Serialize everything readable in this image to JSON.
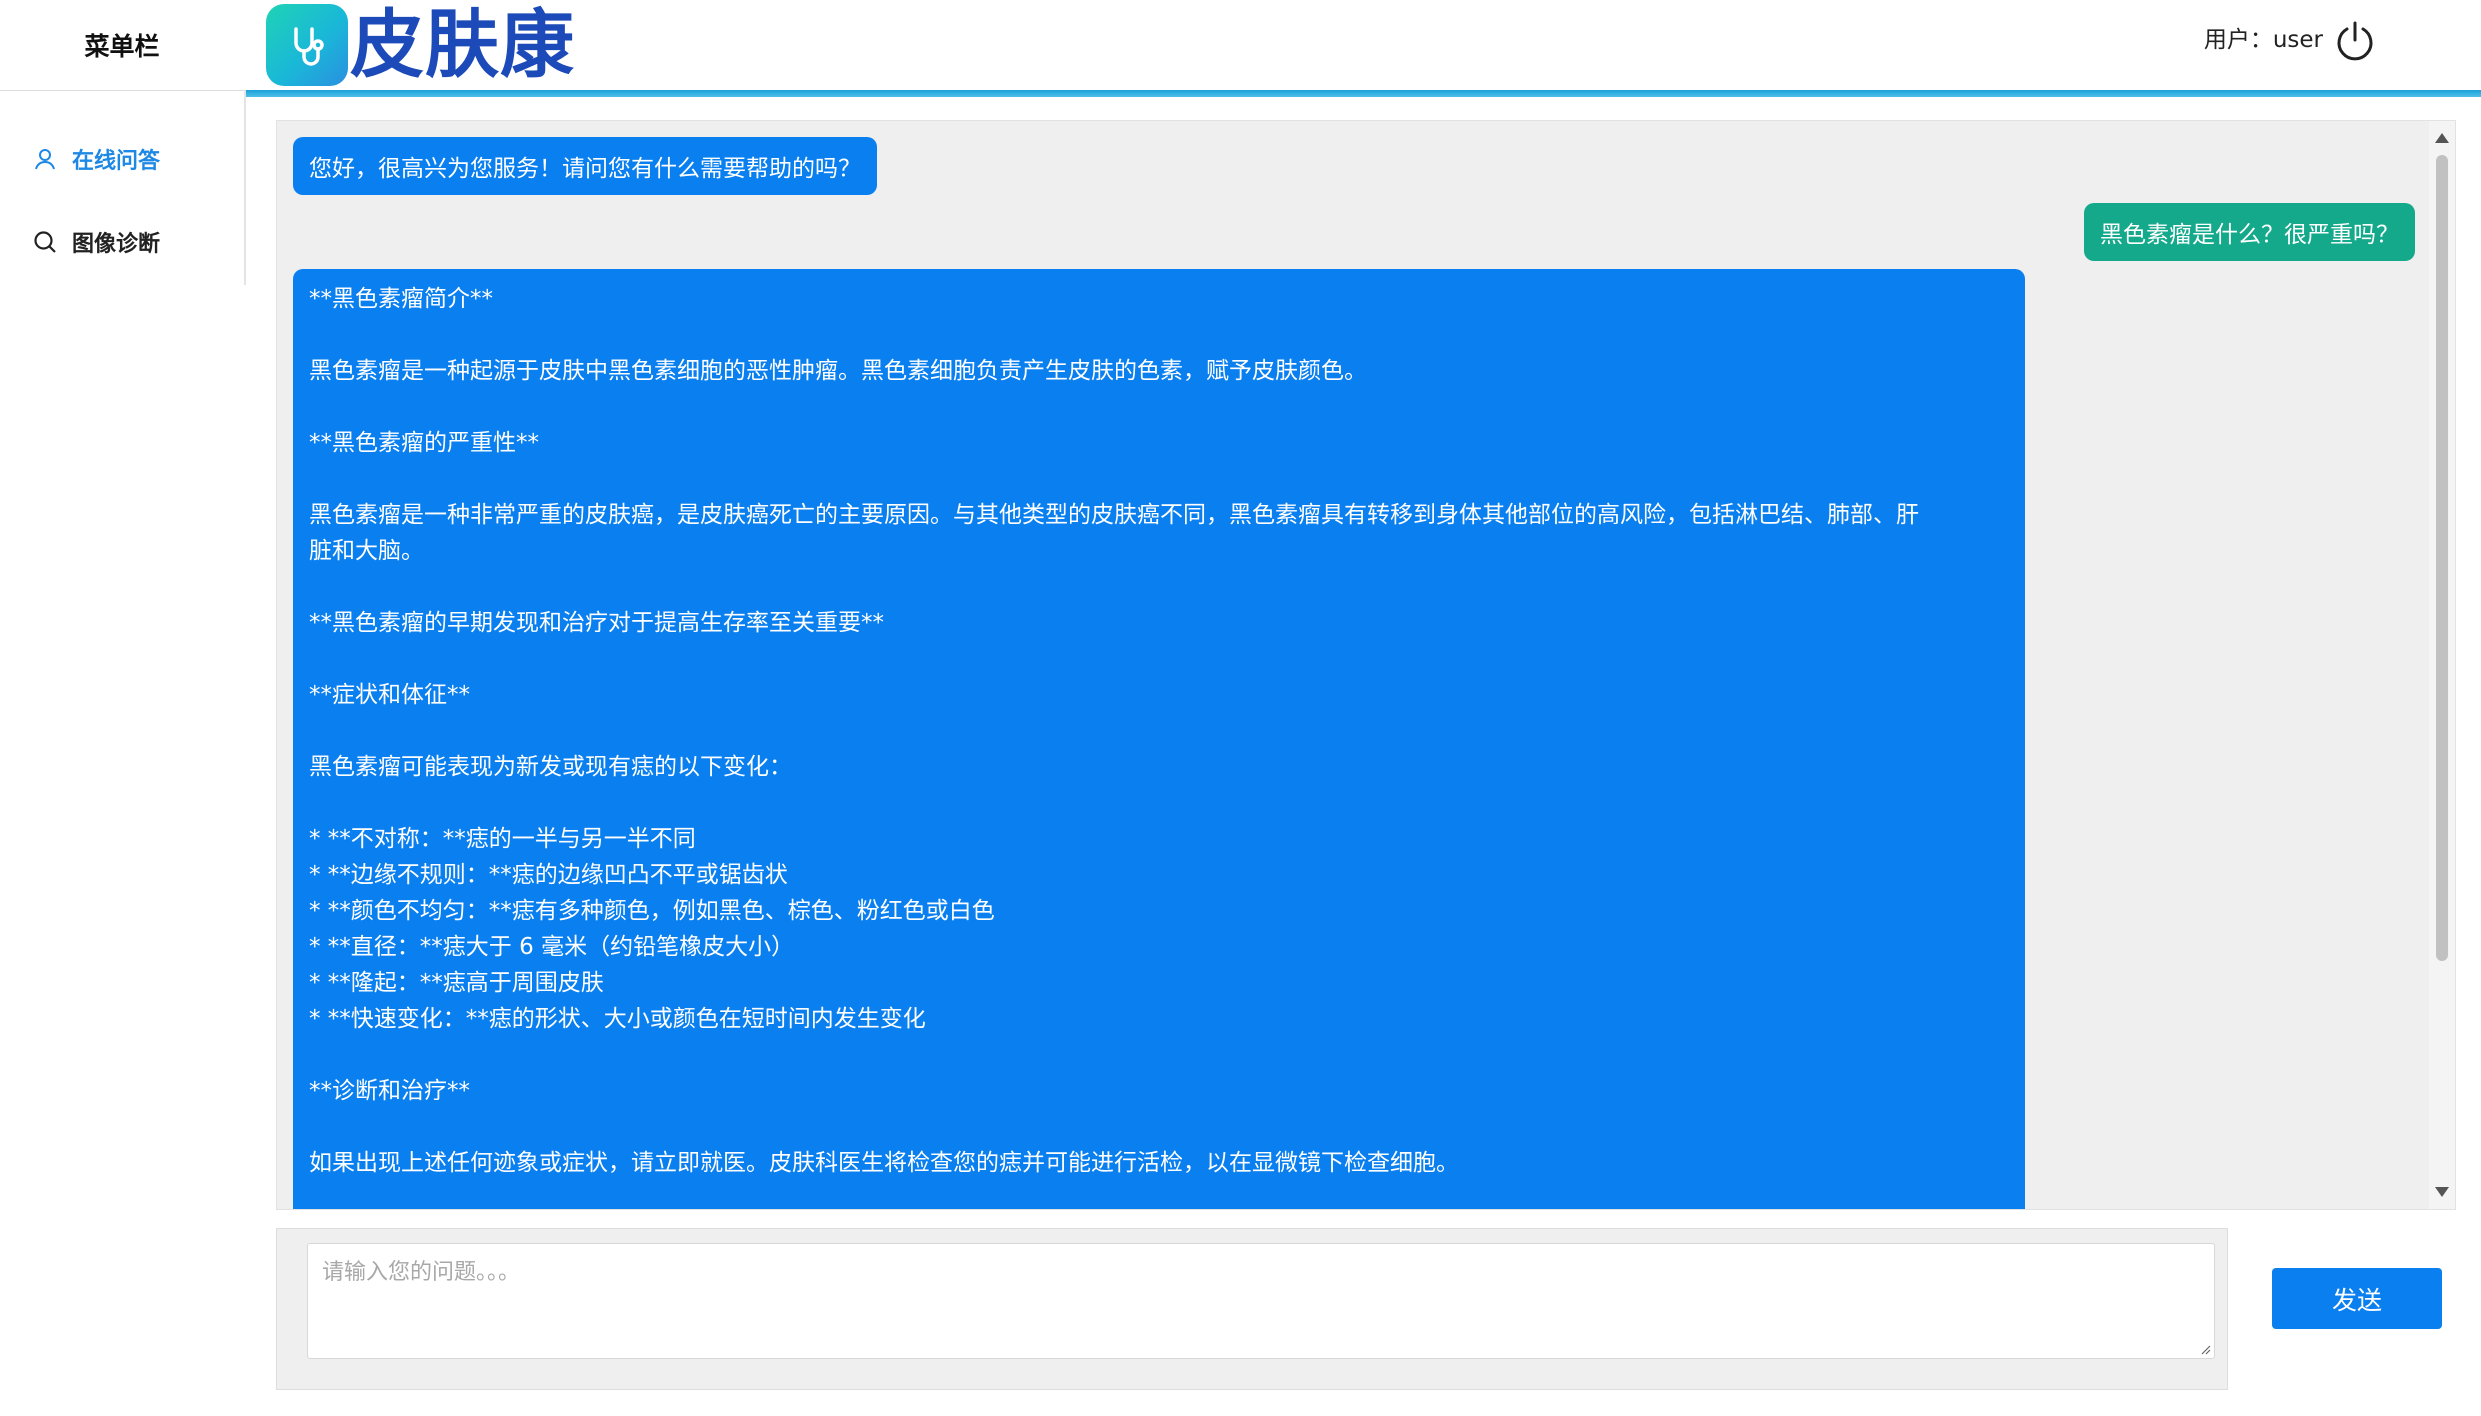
{
  "sidebar": {
    "title": "菜单栏",
    "items": [
      {
        "label": "在线问答",
        "icon": "user-icon",
        "active": true
      },
      {
        "label": "图像诊断",
        "icon": "search-icon",
        "active": false
      }
    ]
  },
  "header": {
    "logo_text": "皮肤康",
    "logo_icon": "stethoscope-icon",
    "user_label": "用户：user",
    "power_icon": "power-icon"
  },
  "chat": {
    "greeting": "您好，很高兴为您服务！请问您有什么需要帮助的吗？",
    "user_question": "黑色素瘤是什么？很严重吗？",
    "answer_lines": [
      "**黑色素瘤简介**",
      "",
      "黑色素瘤是一种起源于皮肤中黑色素细胞的恶性肿瘤。黑色素细胞负责产生皮肤的色素，赋予皮肤颜色。",
      "",
      "**黑色素瘤的严重性**",
      "",
      "黑色素瘤是一种非常严重的皮肤癌，是皮肤癌死亡的主要原因。与其他类型的皮肤癌不同，黑色素瘤具有转移到身体其他部位的高风险，包括淋巴结、肺部、肝",
      "脏和大脑。",
      "",
      "**黑色素瘤的早期发现和治疗对于提高生存率至关重要**",
      "",
      "**症状和体征**",
      "",
      "黑色素瘤可能表现为新发或现有痣的以下变化：",
      "",
      "* **不对称：**痣的一半与另一半不同",
      "* **边缘不规则：**痣的边缘凹凸不平或锯齿状",
      "* **颜色不均匀：**痣有多种颜色，例如黑色、棕色、粉红色或白色",
      "* **直径：**痣大于 6 毫米（约铅笔橡皮大小）",
      "* **隆起：**痣高于周围皮肤",
      "* **快速变化：**痣的形状、大小或颜色在短时间内发生变化",
      "",
      "**诊断和治疗**",
      "",
      "如果出现上述任何迹象或症状，请立即就医。皮肤科医生将检查您的痣并可能进行活检，以在显微镜下检查细胞。"
    ]
  },
  "input": {
    "placeholder": "请输入您的问题。。。",
    "value": "",
    "send_label": "发送"
  },
  "colors": {
    "accent": "#0a7ff0",
    "user_bubble": "#13a98a",
    "logo_text": "#1c4ab8",
    "header_line": "#1aa0d8"
  }
}
